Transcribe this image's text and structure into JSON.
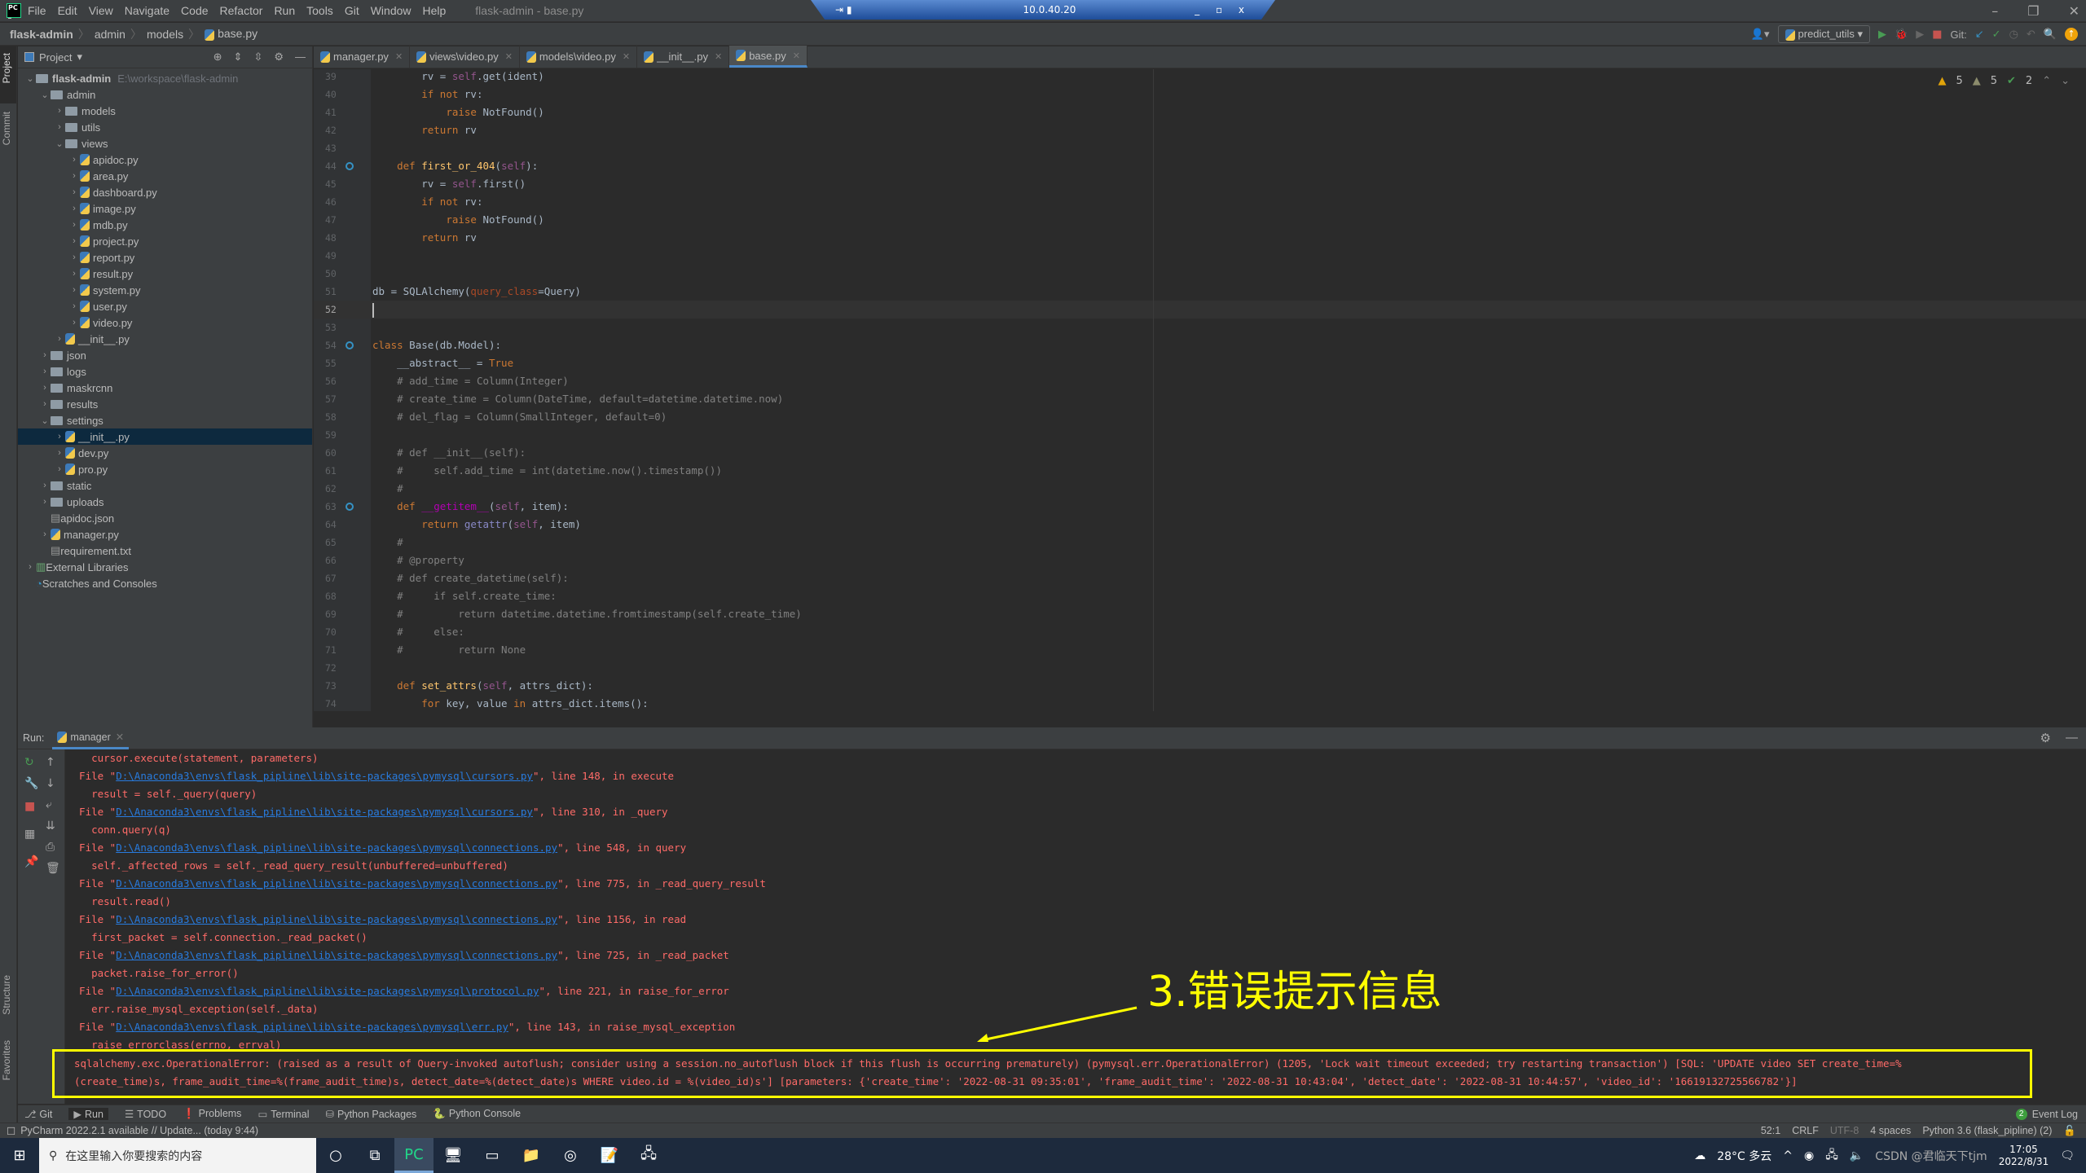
{
  "window": {
    "title": "flask-admin - base.py",
    "menu": [
      "File",
      "Edit",
      "View",
      "Navigate",
      "Code",
      "Refactor",
      "Run",
      "Tools",
      "Git",
      "Window",
      "Help"
    ],
    "remote_host": "10.0.40.20"
  },
  "breadcrumb": [
    "flask-admin",
    "admin",
    "models",
    "base.py"
  ],
  "toolbar": {
    "run_config": "predict_utils",
    "git_label": "Git:"
  },
  "project": {
    "header": "Project",
    "tree": [
      {
        "label": "flask-admin",
        "path": "E:\\workspace\\flask-admin",
        "depth": 0,
        "type": "folder",
        "open": true,
        "bold": true
      },
      {
        "label": "admin",
        "depth": 1,
        "type": "folder",
        "open": true
      },
      {
        "label": "models",
        "depth": 2,
        "type": "folder",
        "open": false
      },
      {
        "label": "utils",
        "depth": 2,
        "type": "folder",
        "open": false
      },
      {
        "label": "views",
        "depth": 2,
        "type": "folder",
        "open": true
      },
      {
        "label": "apidoc.py",
        "depth": 3,
        "type": "py"
      },
      {
        "label": "area.py",
        "depth": 3,
        "type": "py"
      },
      {
        "label": "dashboard.py",
        "depth": 3,
        "type": "py"
      },
      {
        "label": "image.py",
        "depth": 3,
        "type": "py"
      },
      {
        "label": "mdb.py",
        "depth": 3,
        "type": "py"
      },
      {
        "label": "project.py",
        "depth": 3,
        "type": "py"
      },
      {
        "label": "report.py",
        "depth": 3,
        "type": "py"
      },
      {
        "label": "result.py",
        "depth": 3,
        "type": "py"
      },
      {
        "label": "system.py",
        "depth": 3,
        "type": "py"
      },
      {
        "label": "user.py",
        "depth": 3,
        "type": "py"
      },
      {
        "label": "video.py",
        "depth": 3,
        "type": "py"
      },
      {
        "label": "__init__.py",
        "depth": 2,
        "type": "py"
      },
      {
        "label": "json",
        "depth": 1,
        "type": "folder",
        "open": false
      },
      {
        "label": "logs",
        "depth": 1,
        "type": "folder",
        "open": false
      },
      {
        "label": "maskrcnn",
        "depth": 1,
        "type": "folder",
        "open": false
      },
      {
        "label": "results",
        "depth": 1,
        "type": "folder",
        "open": false
      },
      {
        "label": "settings",
        "depth": 1,
        "type": "folder",
        "open": true
      },
      {
        "label": "__init__.py",
        "depth": 2,
        "type": "py",
        "selected": true
      },
      {
        "label": "dev.py",
        "depth": 2,
        "type": "py"
      },
      {
        "label": "pro.py",
        "depth": 2,
        "type": "py"
      },
      {
        "label": "static",
        "depth": 1,
        "type": "folder",
        "open": false
      },
      {
        "label": "uploads",
        "depth": 1,
        "type": "folder",
        "open": false
      },
      {
        "label": "apidoc.json",
        "depth": 1,
        "type": "file"
      },
      {
        "label": "manager.py",
        "depth": 1,
        "type": "py"
      },
      {
        "label": "requirement.txt",
        "depth": 1,
        "type": "file"
      },
      {
        "label": "External Libraries",
        "depth": 0,
        "type": "lib"
      },
      {
        "label": "Scratches and Consoles",
        "depth": 0,
        "type": "scratch"
      }
    ]
  },
  "tabs": [
    {
      "label": "manager.py"
    },
    {
      "label": "views\\video.py"
    },
    {
      "label": "models\\video.py"
    },
    {
      "label": "__init__.py"
    },
    {
      "label": "base.py",
      "active": true
    }
  ],
  "inspections": {
    "warnings": "5",
    "weak_warnings": "5",
    "typos": "2"
  },
  "editor": {
    "current_line": 52,
    "lines": [
      {
        "n": 39,
        "html": "        rv = <span class=sf>self</span>.get(ident)"
      },
      {
        "n": 40,
        "html": "        <span class=kw>if not</span> rv:"
      },
      {
        "n": 41,
        "html": "            <span class=kw>raise</span> NotFound()"
      },
      {
        "n": 42,
        "html": "        <span class=kw>return</span> rv"
      },
      {
        "n": 43,
        "html": ""
      },
      {
        "n": 44,
        "html": "    <span class=kw>def</span> <span class=fn>first_or_404</span>(<span class=sf>self</span>):",
        "icon": true
      },
      {
        "n": 45,
        "html": "        rv = <span class=sf>self</span>.first()"
      },
      {
        "n": 46,
        "html": "        <span class=kw>if not</span> rv:"
      },
      {
        "n": 47,
        "html": "            <span class=kw>raise</span> NotFound()"
      },
      {
        "n": 48,
        "html": "        <span class=kw>return</span> rv"
      },
      {
        "n": 49,
        "html": ""
      },
      {
        "n": 50,
        "html": ""
      },
      {
        "n": 51,
        "html": "db = SQLAlchemy(<span class=pr>query_class</span>=Query)"
      },
      {
        "n": 52,
        "html": ""
      },
      {
        "n": 53,
        "html": ""
      },
      {
        "n": 54,
        "html": "<span class=kw>class</span> Base(db.Model):",
        "icon": true
      },
      {
        "n": 55,
        "html": "    __abstract__ = <span class=kw>True</span>"
      },
      {
        "n": 56,
        "html": "    <span class=cm># add_time = Column(Integer)</span>"
      },
      {
        "n": 57,
        "html": "    <span class=cm># create_time = Column(DateTime, default=datetime.datetime.now)</span>"
      },
      {
        "n": 58,
        "html": "    <span class=cm># del_flag = Column(SmallInteger, default=0)</span>"
      },
      {
        "n": 59,
        "html": ""
      },
      {
        "n": 60,
        "html": "    <span class=cm># def __init__(self):</span>"
      },
      {
        "n": 61,
        "html": "    <span class=cm>#     self.add_time = int(datetime.now().timestamp())</span>"
      },
      {
        "n": 62,
        "html": "    <span class=cm>#</span>"
      },
      {
        "n": 63,
        "html": "    <span class=kw>def</span> <span class=mg>__getitem__</span>(<span class=sf>self</span>, item):",
        "icon": true
      },
      {
        "n": 64,
        "html": "        <span class=kw>return</span> <span class=bi>getattr</span>(<span class=sf>self</span>, item)"
      },
      {
        "n": 65,
        "html": "    <span class=cm>#</span>"
      },
      {
        "n": 66,
        "html": "    <span class=cm># @property</span>"
      },
      {
        "n": 67,
        "html": "    <span class=cm># def create_datetime(self):</span>"
      },
      {
        "n": 68,
        "html": "    <span class=cm>#     if self.create_time:</span>"
      },
      {
        "n": 69,
        "html": "    <span class=cm>#         return datetime.datetime.fromtimestamp(self.create_time)</span>"
      },
      {
        "n": 70,
        "html": "    <span class=cm>#     else:</span>"
      },
      {
        "n": 71,
        "html": "    <span class=cm>#         return None</span>"
      },
      {
        "n": 72,
        "html": ""
      },
      {
        "n": 73,
        "html": "    <span class=kw>def</span> <span class=fn>set_attrs</span>(<span class=sf>self</span>, attrs_dict):"
      },
      {
        "n": 74,
        "html": "        <span class=kw>for</span> key, value <span class=kw>in</span> attrs_dict.items():"
      }
    ]
  },
  "run": {
    "label": "Run:",
    "tab": "manager",
    "output": [
      {
        "indent": "    ",
        "text": "cursor.execute(statement, parameters)"
      },
      {
        "file": "D:\\Anaconda3\\envs\\flask_pipline\\lib\\site-packages\\pymysql\\cursors.py",
        "tail": ", line 148, in execute"
      },
      {
        "indent": "    ",
        "text": "result = self._query(query)"
      },
      {
        "file": "D:\\Anaconda3\\envs\\flask_pipline\\lib\\site-packages\\pymysql\\cursors.py",
        "tail": ", line 310, in _query"
      },
      {
        "indent": "    ",
        "text": "conn.query(q)"
      },
      {
        "file": "D:\\Anaconda3\\envs\\flask_pipline\\lib\\site-packages\\pymysql\\connections.py",
        "tail": ", line 548, in query"
      },
      {
        "indent": "    ",
        "text": "self._affected_rows = self._read_query_result(unbuffered=unbuffered)"
      },
      {
        "file": "D:\\Anaconda3\\envs\\flask_pipline\\lib\\site-packages\\pymysql\\connections.py",
        "tail": ", line 775, in _read_query_result"
      },
      {
        "indent": "    ",
        "text": "result.read()"
      },
      {
        "file": "D:\\Anaconda3\\envs\\flask_pipline\\lib\\site-packages\\pymysql\\connections.py",
        "tail": ", line 1156, in read"
      },
      {
        "indent": "    ",
        "text": "first_packet = self.connection._read_packet()"
      },
      {
        "file": "D:\\Anaconda3\\envs\\flask_pipline\\lib\\site-packages\\pymysql\\connections.py",
        "tail": ", line 725, in _read_packet"
      },
      {
        "indent": "    ",
        "text": "packet.raise_for_error()"
      },
      {
        "file": "D:\\Anaconda3\\envs\\flask_pipline\\lib\\site-packages\\pymysql\\protocol.py",
        "tail": ", line 221, in raise_for_error"
      },
      {
        "indent": "    ",
        "text": "err.raise_mysql_exception(self._data)"
      },
      {
        "file": "D:\\Anaconda3\\envs\\flask_pipline\\lib\\site-packages\\pymysql\\err.py",
        "tail": ", line 143, in raise_mysql_exception"
      },
      {
        "indent": "    ",
        "text": "raise errorclass(errno, errval)"
      }
    ],
    "error_line_1": "sqlalchemy.exc.OperationalError: (raised as a result of Query-invoked autoflush; consider using a session.no_autoflush block if this flush is occurring prematurely) (pymysql.err.OperationalError) (1205, 'Lock wait timeout exceeded; try restarting transaction') [SQL: 'UPDATE video SET create_time=%",
    "error_line_2": "(create_time)s, frame_audit_time=%(frame_audit_time)s, detect_date=%(detect_date)s WHERE video.id = %(video_id)s'] [parameters: {'create_time': '2022-08-31 09:35:01', 'frame_audit_time': '2022-08-31 10:43:04', 'detect_date': '2022-08-31 10:44:57', 'video_id': '16619132725566782'}]"
  },
  "annotation": {
    "text": "3.错误提示信息",
    "color": "#ffff00"
  },
  "bottom_tools": [
    "Git",
    "Run",
    "TODO",
    "Problems",
    "Terminal",
    "Python Packages",
    "Python Console"
  ],
  "event_log": {
    "count": "2",
    "label": "Event Log"
  },
  "status": {
    "message": "PyCharm 2022.2.1 available // Update... (today 9:44)",
    "position": "52:1",
    "line_sep": "CRLF",
    "encoding": "UTF-8",
    "indent": "4 spaces",
    "interpreter": "Python 3.6 (flask_pipline) (2)"
  },
  "side_tabs": {
    "project": "Project",
    "commit": "Commit",
    "structure": "Structure",
    "favorites": "Favorites"
  },
  "taskbar": {
    "search_placeholder": "在这里输入你要搜索的内容",
    "weather": "28°C 多云",
    "time": "17:05",
    "date": "2022/8/31",
    "watermark": "CSDN @君临天下tjm"
  },
  "colors": {
    "accent": "#4a88c7",
    "error_text": "#ff6b68",
    "link": "#287bde",
    "highlight_box": "#ffff00"
  }
}
